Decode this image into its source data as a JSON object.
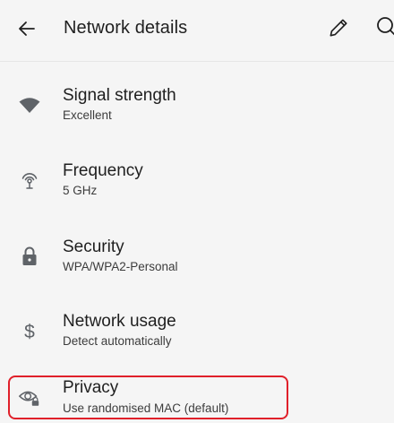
{
  "appbar": {
    "title": "Network details",
    "back_icon": "arrow-left-icon",
    "edit_icon": "pencil-icon",
    "search_icon": "search-icon"
  },
  "items": [
    {
      "label": "Signal strength",
      "value": "Excellent",
      "icon": "wifi-signal-icon"
    },
    {
      "label": "Frequency",
      "value": "5 GHz",
      "icon": "frequency-antenna-icon"
    },
    {
      "label": "Security",
      "value": "WPA/WPA2-Personal",
      "icon": "lock-icon"
    },
    {
      "label": "Network usage",
      "value": "Detect automatically",
      "icon": "dollar-icon"
    },
    {
      "label": "Privacy",
      "value": "Use randomised MAC (default)",
      "icon": "privacy-eye-lock-icon"
    }
  ],
  "colors": {
    "background": "#f5f5f5",
    "icon": "#5f6368",
    "highlight": "#e0202a"
  }
}
